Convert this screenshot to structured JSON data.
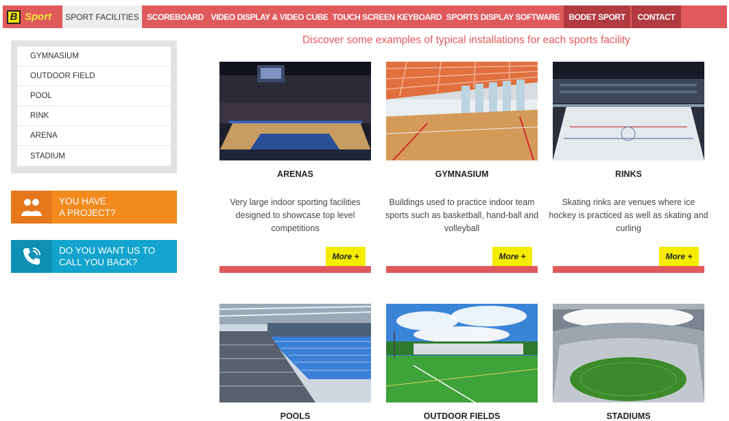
{
  "nav": {
    "logo_letter": "B",
    "logo_text": "Sport",
    "items": [
      {
        "label": "SPORT FACILITIES"
      },
      {
        "label": "SCOREBOARD"
      },
      {
        "label": "VIDEO DISPLAY & VIDEO CUBE"
      },
      {
        "label": "TOUCH SCREEN KEYBOARD"
      },
      {
        "label": "SPORTS DISPLAY SOFTWARE"
      },
      {
        "label": "BODET SPORT"
      },
      {
        "label": "CONTACT"
      }
    ]
  },
  "headline": "Discover some examples of typical installations for each sports facility",
  "sidebar": {
    "items": [
      {
        "label": "GYMNASIUM"
      },
      {
        "label": "OUTDOOR FIELD"
      },
      {
        "label": "POOL"
      },
      {
        "label": "RINK"
      },
      {
        "label": "ARENA"
      },
      {
        "label": "STADIUM"
      }
    ]
  },
  "cta": {
    "project": {
      "line1": "YOU HAVE",
      "line2": "A PROJECT?"
    },
    "callback": {
      "line1": "DO YOU WANT US TO",
      "line2": "CALL YOU BACK?"
    }
  },
  "cards": [
    {
      "title": "ARENAS",
      "desc": "Very large indoor sporting facilities designed to showcase top level competitions",
      "more": "More +"
    },
    {
      "title": "GYMNASIUM",
      "desc": "Buildings used to practice indoor team sports such as basketball, hand-ball and volleyball",
      "more": "More +"
    },
    {
      "title": "RINKS",
      "desc": "Skating rinks are venues where ice hockey is practiced as well as skating and curling",
      "more": "More +"
    },
    {
      "title": "POOLS"
    },
    {
      "title": "OUTDOOR FIELDS"
    },
    {
      "title": "STADIUMS"
    }
  ],
  "colors": {
    "nav_bg": "#e05a5c",
    "nav_dark": "#b03a40",
    "headline": "#e25a58",
    "cta_orange": "#f28a1e",
    "cta_blue": "#12a4cc",
    "more_bg": "#f5ec00"
  }
}
